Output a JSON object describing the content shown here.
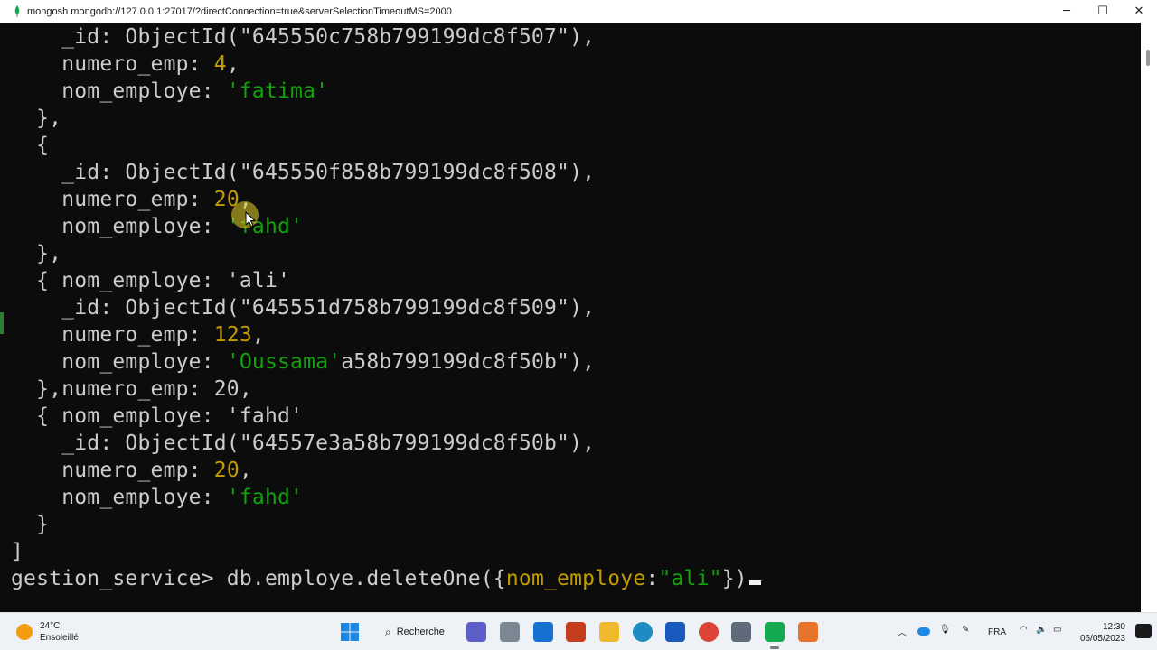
{
  "window": {
    "title": "mongosh mongodb://127.0.0.1:27017/?directConnection=true&serverSelectionTimeoutMS=2000",
    "minimize": "─",
    "maximize": "☐",
    "close": "✕"
  },
  "terminal": {
    "lines": [
      [
        {
          "t": "    _id: ObjectId(\"645550c758b799199dc8f507\"),",
          "c": ""
        }
      ],
      [
        {
          "t": "    numero_emp: ",
          "c": ""
        },
        {
          "t": "4",
          "c": "num"
        },
        {
          "t": ",",
          "c": ""
        }
      ],
      [
        {
          "t": "    nom_employe: ",
          "c": ""
        },
        {
          "t": "'fatima'",
          "c": "str"
        }
      ],
      [
        {
          "t": "  },",
          "c": ""
        }
      ],
      [
        {
          "t": "  {",
          "c": ""
        }
      ],
      [
        {
          "t": "    _id: ObjectId(\"645550f858b799199dc8f508\"),",
          "c": ""
        }
      ],
      [
        {
          "t": "    numero_emp: ",
          "c": ""
        },
        {
          "t": "20",
          "c": "num"
        },
        {
          "t": ",",
          "c": ""
        }
      ],
      [
        {
          "t": "    nom_employe: ",
          "c": ""
        },
        {
          "t": "'fahd'",
          "c": "str"
        }
      ],
      [
        {
          "t": "  },",
          "c": ""
        }
      ],
      [
        {
          "t": "  { nom_employe: 'ali'",
          "c": ""
        }
      ],
      [
        {
          "t": "    _id: ObjectId(\"645551d758b799199dc8f509\"),",
          "c": ""
        }
      ],
      [
        {
          "t": "    numero_emp: ",
          "c": ""
        },
        {
          "t": "123",
          "c": "num"
        },
        {
          "t": ",",
          "c": ""
        }
      ],
      [
        {
          "t": "    nom_employe: ",
          "c": ""
        },
        {
          "t": "'Oussama'",
          "c": "str"
        },
        {
          "t": "a58b799199dc8f50b\"),",
          "c": ""
        }
      ],
      [
        {
          "t": "  },numero_emp: 20,",
          "c": ""
        }
      ],
      [
        {
          "t": "  { nom_employe: 'fahd'",
          "c": ""
        }
      ],
      [
        {
          "t": "    _id: ObjectId(\"64557e3a58b799199dc8f50b\"),",
          "c": ""
        }
      ],
      [
        {
          "t": "    numero_emp: ",
          "c": ""
        },
        {
          "t": "20",
          "c": "num"
        },
        {
          "t": ",",
          "c": ""
        }
      ],
      [
        {
          "t": "    nom_employe: ",
          "c": ""
        },
        {
          "t": "'fahd'",
          "c": "str"
        }
      ],
      [
        {
          "t": "  }",
          "c": ""
        }
      ],
      [
        {
          "t": "]",
          "c": ""
        }
      ],
      [
        {
          "t": "gestion_service> db.employe.deleteOne({",
          "c": ""
        },
        {
          "t": "nom_employe",
          "c": "key"
        },
        {
          "t": ":",
          "c": ""
        },
        {
          "t": "\"ali\"",
          "c": "str"
        },
        {
          "t": "})",
          "c": ""
        }
      ]
    ]
  },
  "taskbar": {
    "weather_temp": "24°C",
    "weather_desc": "Ensoleillé",
    "search_label": "Recherche",
    "language": "FRA",
    "time": "12:30",
    "date": "06/05/2023"
  }
}
